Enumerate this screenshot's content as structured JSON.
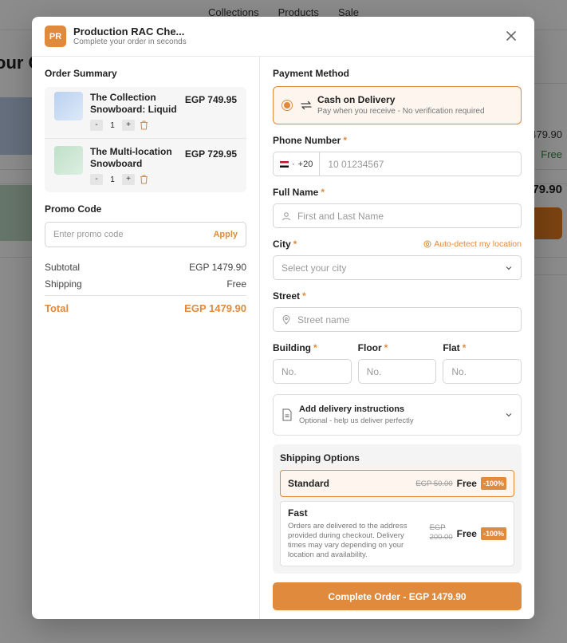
{
  "background": {
    "nav": [
      "Collections",
      "Products",
      "Sale"
    ],
    "title_fragment": "our C",
    "price_fragment": "479.90",
    "free_fragment": "Free",
    "total_fragment": "79.90"
  },
  "header": {
    "logo": "PR",
    "title": "Production RAC Che...",
    "subtitle": "Complete your order in seconds"
  },
  "order": {
    "title": "Order Summary",
    "items": [
      {
        "name": "The Collection Snowboard: Liquid",
        "price": "EGP 749.95",
        "qty": "1",
        "thumb_color": "#c6dbf4"
      },
      {
        "name": "The Multi-location Snowboard",
        "price": "EGP 729.95",
        "qty": "1",
        "thumb_color": "#c9e8d2"
      }
    ],
    "minus": "-",
    "plus": "+"
  },
  "promo": {
    "title": "Promo Code",
    "placeholder": "Enter promo code",
    "apply": "Apply"
  },
  "summary": {
    "subtotal_label": "Subtotal",
    "subtotal": "EGP 1479.90",
    "shipping_label": "Shipping",
    "shipping": "Free",
    "total_label": "Total",
    "total": "EGP 1479.90"
  },
  "payment": {
    "title": "Payment Method",
    "option": "Cash on Delivery",
    "option_sub": "Pay when you receive - No verification required"
  },
  "form": {
    "phone_label": "Phone Number",
    "phone_code": "+20",
    "phone_sep": "·",
    "phone_placeholder": "10 01234567",
    "name_label": "Full Name",
    "name_placeholder": "First and Last Name",
    "city_label": "City",
    "auto_detect": "Auto-detect my location",
    "city_placeholder": "Select your city",
    "street_label": "Street",
    "street_placeholder": "Street name",
    "building_label": "Building",
    "floor_label": "Floor",
    "flat_label": "Flat",
    "no_placeholder": "No.",
    "required": "*"
  },
  "delivery": {
    "title": "Add delivery instructions",
    "sub": "Optional - help us deliver perfectly"
  },
  "shipping": {
    "title": "Shipping Options",
    "options": [
      {
        "name": "Standard",
        "old": "EGP 50.00",
        "price": "Free",
        "discount": "-100%"
      },
      {
        "name": "Fast",
        "desc": "Orders are delivered to the address provided during checkout. Delivery times may vary depending on your location and availability.",
        "old_line1": "EGP",
        "old_line2": "200.00",
        "price": "Free",
        "discount": "-100%"
      }
    ]
  },
  "complete": "Complete Order - EGP 1479.90",
  "colors": {
    "accent": "#e08a3e",
    "free_green": "#2a8a3e"
  },
  "icons": [
    "close-icon",
    "repeat-icon",
    "user-icon",
    "location-icon",
    "target-icon",
    "chevron-down-icon",
    "document-icon",
    "trash-icon",
    "egypt-flag-icon"
  ]
}
